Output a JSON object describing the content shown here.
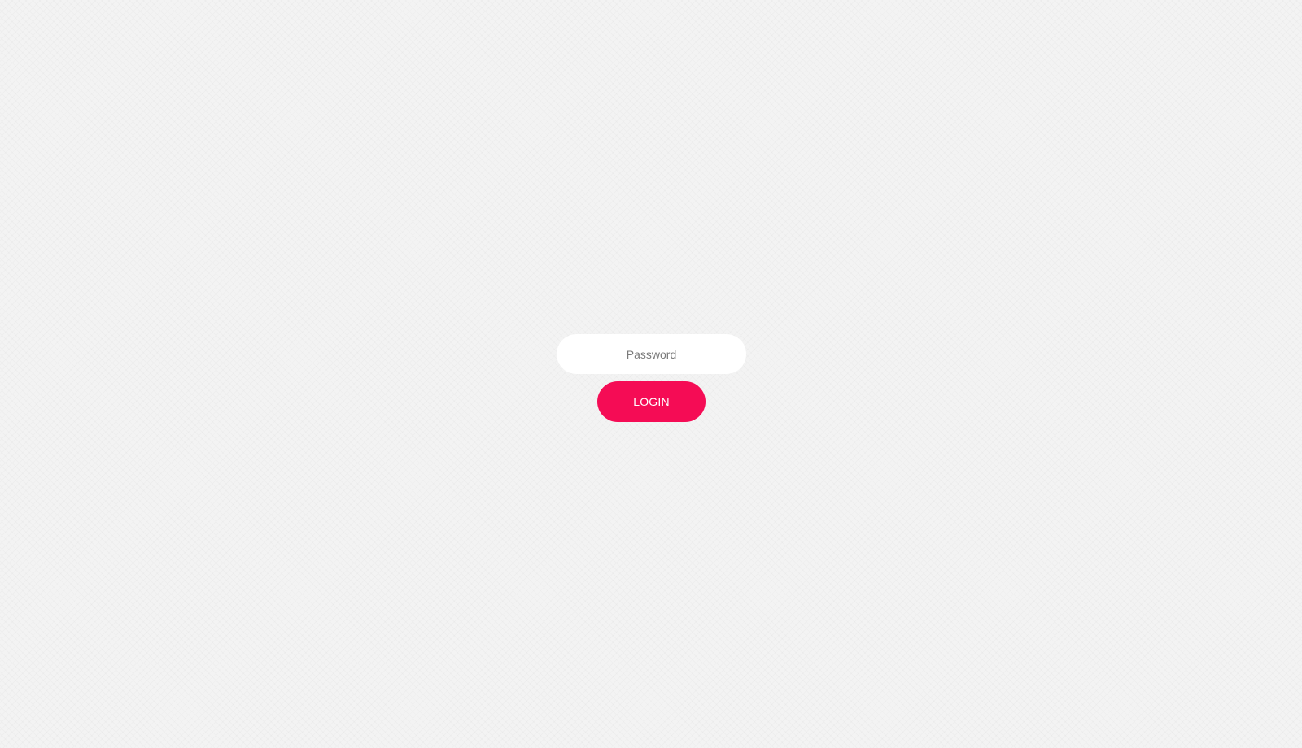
{
  "login_form": {
    "password": {
      "placeholder": "Password",
      "value": ""
    },
    "login_button_label": "LOGIN"
  },
  "colors": {
    "background": "#f3f3f3",
    "field_background": "#ffffff",
    "accent": "#f50c55",
    "button_text": "#ffffff"
  }
}
